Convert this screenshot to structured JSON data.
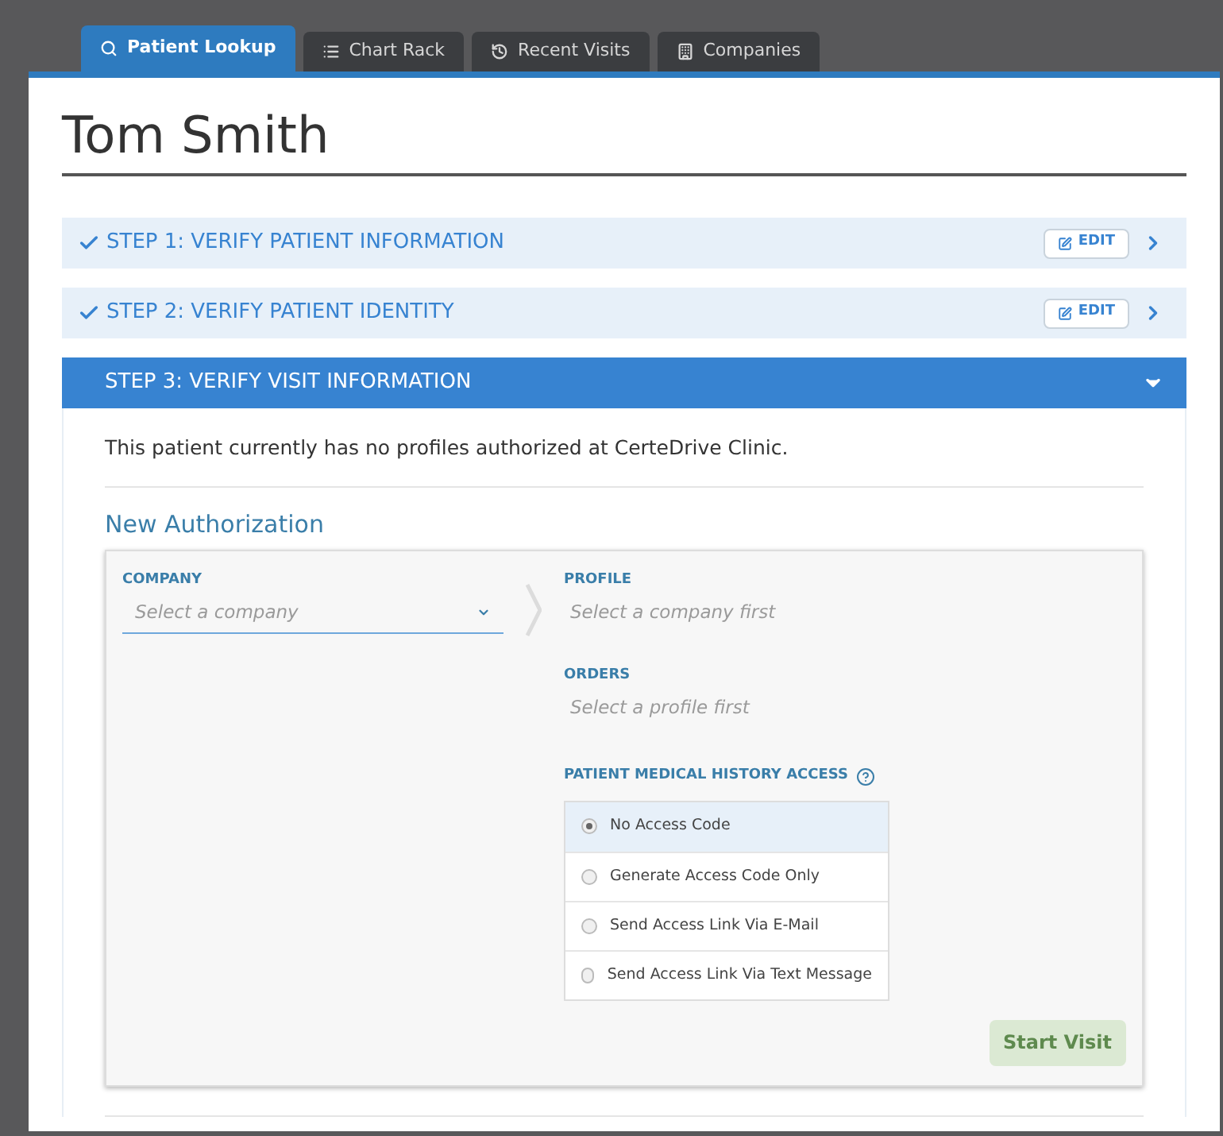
{
  "tabs": [
    {
      "label": "Patient Lookup",
      "kind": "search",
      "selected": true
    },
    {
      "label": "Chart Rack",
      "kind": "list",
      "selected": false
    },
    {
      "label": "Recent Visits",
      "kind": "history",
      "selected": false
    },
    {
      "label": "Companies",
      "kind": "building",
      "selected": false
    }
  ],
  "patient_name": "Tom Smith",
  "steps": [
    {
      "title": "STEP 1: VERIFY PATIENT INFORMATION",
      "completed": true,
      "expanded": false,
      "edit_label": "EDIT"
    },
    {
      "title": "STEP 2: VERIFY PATIENT IDENTITY",
      "completed": true,
      "expanded": false,
      "edit_label": "EDIT"
    },
    {
      "title": "STEP 3: VERIFY VISIT INFORMATION",
      "completed": false,
      "expanded": true
    }
  ],
  "notice": "This patient currently has no profiles authorized at CerteDrive Clinic.",
  "new_authorization": {
    "heading": "New Authorization",
    "company": {
      "label": "COMPANY",
      "placeholder": "Select a company"
    },
    "profile": {
      "label": "PROFILE",
      "placeholder": "Select a company first"
    },
    "orders": {
      "label": "ORDERS",
      "placeholder": "Select a profile first"
    },
    "history_access": {
      "label": "PATIENT MEDICAL HISTORY ACCESS",
      "options": [
        {
          "label": "No Access Code",
          "selected": true
        },
        {
          "label": "Generate Access Code Only",
          "selected": false
        },
        {
          "label": "Send Access Link Via E-Mail",
          "selected": false
        },
        {
          "label": "Send Access Link Via Text Message",
          "selected": false
        }
      ]
    },
    "start_button": {
      "label": "Start Visit",
      "disabled": true
    }
  }
}
